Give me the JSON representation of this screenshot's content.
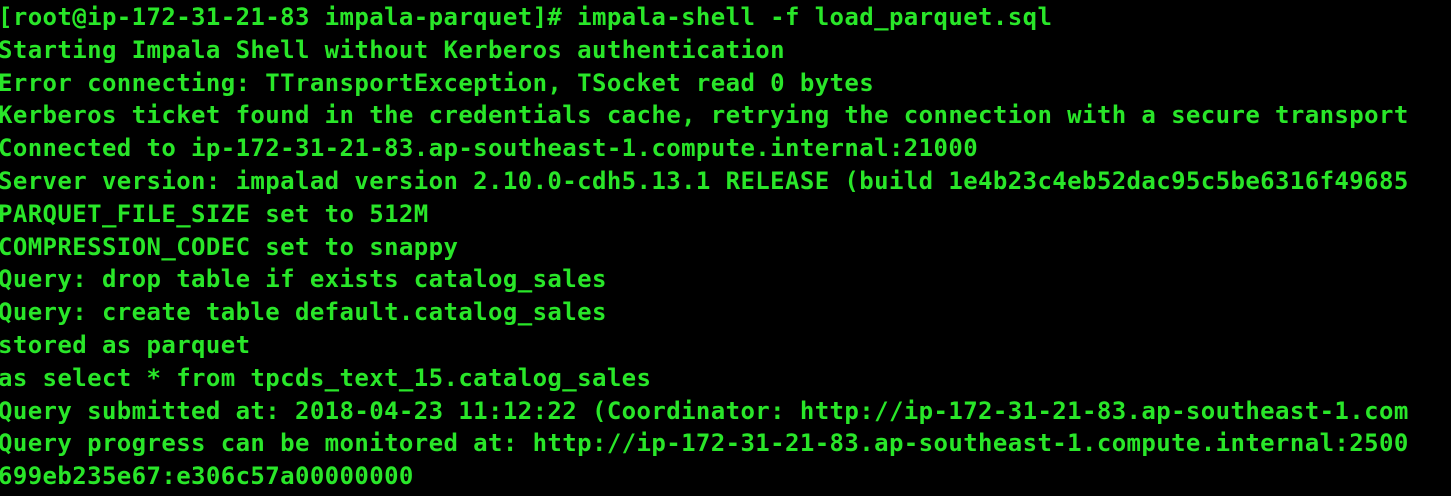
{
  "terminal": {
    "text_color": "#29e629",
    "background": "#000000",
    "lines": [
      "[root@ip-172-31-21-83 impala-parquet]# impala-shell -f load_parquet.sql",
      "Starting Impala Shell without Kerberos authentication",
      "Error connecting: TTransportException, TSocket read 0 bytes",
      "Kerberos ticket found in the credentials cache, retrying the connection with a secure transport",
      "Connected to ip-172-31-21-83.ap-southeast-1.compute.internal:21000",
      "Server version: impalad version 2.10.0-cdh5.13.1 RELEASE (build 1e4b23c4eb52dac95c5be6316f49685",
      "PARQUET_FILE_SIZE set to 512M",
      "COMPRESSION_CODEC set to snappy",
      "Query: drop table if exists catalog_sales",
      "Query: create table default.catalog_sales",
      "stored as parquet",
      "as select * from tpcds_text_15.catalog_sales",
      "Query submitted at: 2018-04-23 11:12:22 (Coordinator: http://ip-172-31-21-83.ap-southeast-1.com",
      "Query progress can be monitored at: http://ip-172-31-21-83.ap-southeast-1.compute.internal:2500",
      "699eb235e67:e306c57a00000000"
    ]
  }
}
